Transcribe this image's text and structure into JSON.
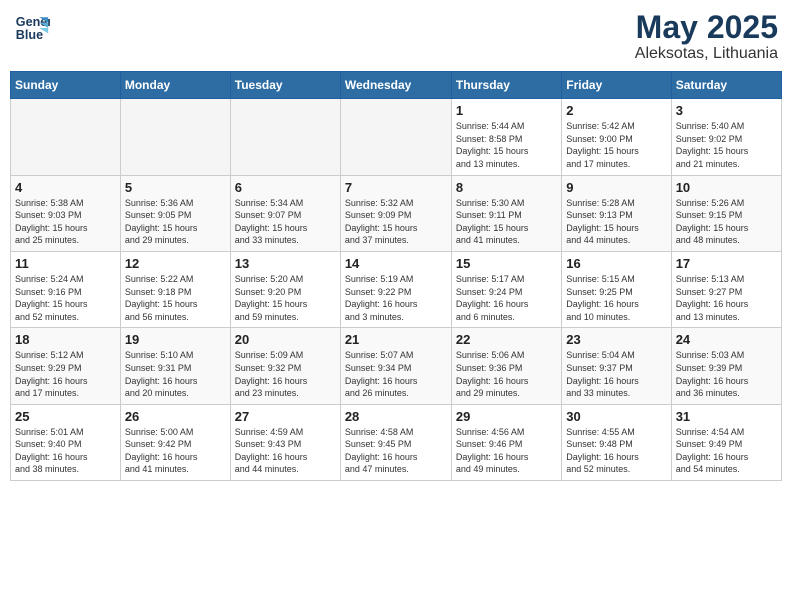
{
  "header": {
    "logo_line1": "General",
    "logo_line2": "Blue",
    "month_year": "May 2025",
    "location": "Aleksotas, Lithuania"
  },
  "weekdays": [
    "Sunday",
    "Monday",
    "Tuesday",
    "Wednesday",
    "Thursday",
    "Friday",
    "Saturday"
  ],
  "weeks": [
    [
      {
        "day": "",
        "info": ""
      },
      {
        "day": "",
        "info": ""
      },
      {
        "day": "",
        "info": ""
      },
      {
        "day": "",
        "info": ""
      },
      {
        "day": "1",
        "info": "Sunrise: 5:44 AM\nSunset: 8:58 PM\nDaylight: 15 hours\nand 13 minutes."
      },
      {
        "day": "2",
        "info": "Sunrise: 5:42 AM\nSunset: 9:00 PM\nDaylight: 15 hours\nand 17 minutes."
      },
      {
        "day": "3",
        "info": "Sunrise: 5:40 AM\nSunset: 9:02 PM\nDaylight: 15 hours\nand 21 minutes."
      }
    ],
    [
      {
        "day": "4",
        "info": "Sunrise: 5:38 AM\nSunset: 9:03 PM\nDaylight: 15 hours\nand 25 minutes."
      },
      {
        "day": "5",
        "info": "Sunrise: 5:36 AM\nSunset: 9:05 PM\nDaylight: 15 hours\nand 29 minutes."
      },
      {
        "day": "6",
        "info": "Sunrise: 5:34 AM\nSunset: 9:07 PM\nDaylight: 15 hours\nand 33 minutes."
      },
      {
        "day": "7",
        "info": "Sunrise: 5:32 AM\nSunset: 9:09 PM\nDaylight: 15 hours\nand 37 minutes."
      },
      {
        "day": "8",
        "info": "Sunrise: 5:30 AM\nSunset: 9:11 PM\nDaylight: 15 hours\nand 41 minutes."
      },
      {
        "day": "9",
        "info": "Sunrise: 5:28 AM\nSunset: 9:13 PM\nDaylight: 15 hours\nand 44 minutes."
      },
      {
        "day": "10",
        "info": "Sunrise: 5:26 AM\nSunset: 9:15 PM\nDaylight: 15 hours\nand 48 minutes."
      }
    ],
    [
      {
        "day": "11",
        "info": "Sunrise: 5:24 AM\nSunset: 9:16 PM\nDaylight: 15 hours\nand 52 minutes."
      },
      {
        "day": "12",
        "info": "Sunrise: 5:22 AM\nSunset: 9:18 PM\nDaylight: 15 hours\nand 56 minutes."
      },
      {
        "day": "13",
        "info": "Sunrise: 5:20 AM\nSunset: 9:20 PM\nDaylight: 15 hours\nand 59 minutes."
      },
      {
        "day": "14",
        "info": "Sunrise: 5:19 AM\nSunset: 9:22 PM\nDaylight: 16 hours\nand 3 minutes."
      },
      {
        "day": "15",
        "info": "Sunrise: 5:17 AM\nSunset: 9:24 PM\nDaylight: 16 hours\nand 6 minutes."
      },
      {
        "day": "16",
        "info": "Sunrise: 5:15 AM\nSunset: 9:25 PM\nDaylight: 16 hours\nand 10 minutes."
      },
      {
        "day": "17",
        "info": "Sunrise: 5:13 AM\nSunset: 9:27 PM\nDaylight: 16 hours\nand 13 minutes."
      }
    ],
    [
      {
        "day": "18",
        "info": "Sunrise: 5:12 AM\nSunset: 9:29 PM\nDaylight: 16 hours\nand 17 minutes."
      },
      {
        "day": "19",
        "info": "Sunrise: 5:10 AM\nSunset: 9:31 PM\nDaylight: 16 hours\nand 20 minutes."
      },
      {
        "day": "20",
        "info": "Sunrise: 5:09 AM\nSunset: 9:32 PM\nDaylight: 16 hours\nand 23 minutes."
      },
      {
        "day": "21",
        "info": "Sunrise: 5:07 AM\nSunset: 9:34 PM\nDaylight: 16 hours\nand 26 minutes."
      },
      {
        "day": "22",
        "info": "Sunrise: 5:06 AM\nSunset: 9:36 PM\nDaylight: 16 hours\nand 29 minutes."
      },
      {
        "day": "23",
        "info": "Sunrise: 5:04 AM\nSunset: 9:37 PM\nDaylight: 16 hours\nand 33 minutes."
      },
      {
        "day": "24",
        "info": "Sunrise: 5:03 AM\nSunset: 9:39 PM\nDaylight: 16 hours\nand 36 minutes."
      }
    ],
    [
      {
        "day": "25",
        "info": "Sunrise: 5:01 AM\nSunset: 9:40 PM\nDaylight: 16 hours\nand 38 minutes."
      },
      {
        "day": "26",
        "info": "Sunrise: 5:00 AM\nSunset: 9:42 PM\nDaylight: 16 hours\nand 41 minutes."
      },
      {
        "day": "27",
        "info": "Sunrise: 4:59 AM\nSunset: 9:43 PM\nDaylight: 16 hours\nand 44 minutes."
      },
      {
        "day": "28",
        "info": "Sunrise: 4:58 AM\nSunset: 9:45 PM\nDaylight: 16 hours\nand 47 minutes."
      },
      {
        "day": "29",
        "info": "Sunrise: 4:56 AM\nSunset: 9:46 PM\nDaylight: 16 hours\nand 49 minutes."
      },
      {
        "day": "30",
        "info": "Sunrise: 4:55 AM\nSunset: 9:48 PM\nDaylight: 16 hours\nand 52 minutes."
      },
      {
        "day": "31",
        "info": "Sunrise: 4:54 AM\nSunset: 9:49 PM\nDaylight: 16 hours\nand 54 minutes."
      }
    ]
  ]
}
